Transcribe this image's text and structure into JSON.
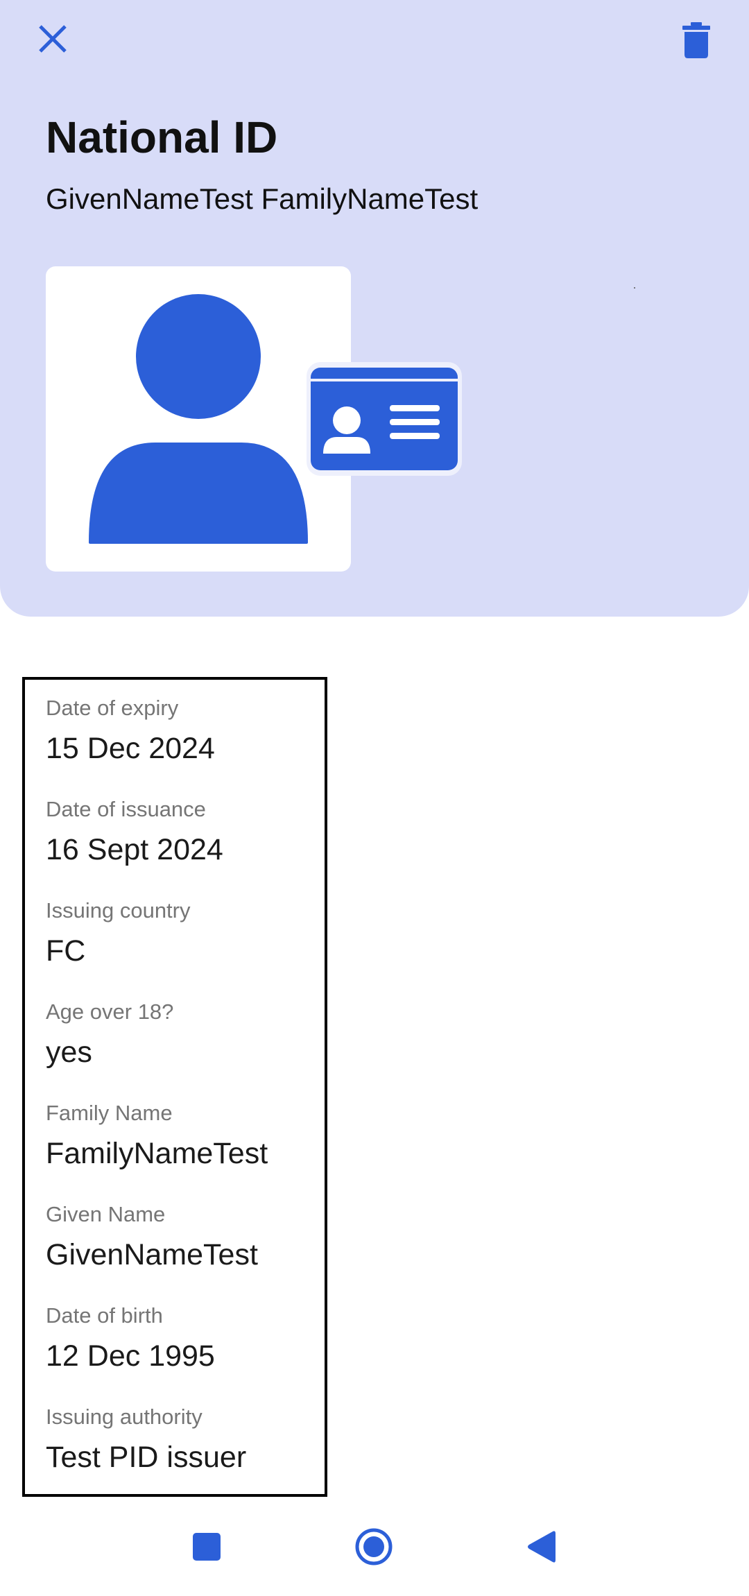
{
  "header": {
    "title": "National ID",
    "holder_name": "GivenNameTest FamilyNameTest",
    "close_icon": "close-icon",
    "delete_icon": "trash-icon",
    "background_color": "#d8dcf8",
    "accent_color": "#2c5fd8"
  },
  "details": [
    {
      "label": "Date of expiry",
      "value": "15 Dec 2024"
    },
    {
      "label": "Date of issuance",
      "value": "16 Sept 2024"
    },
    {
      "label": "Issuing country",
      "value": "FC"
    },
    {
      "label": "Age over 18?",
      "value": "yes"
    },
    {
      "label": "Family Name",
      "value": "FamilyNameTest"
    },
    {
      "label": "Given Name",
      "value": "GivenNameTest"
    },
    {
      "label": "Date of birth",
      "value": "12 Dec 1995"
    },
    {
      "label": "Issuing authority",
      "value": "Test PID issuer"
    }
  ],
  "navbar": {
    "recents_icon": "square-icon",
    "home_icon": "circle-icon",
    "back_icon": "triangle-back-icon"
  }
}
